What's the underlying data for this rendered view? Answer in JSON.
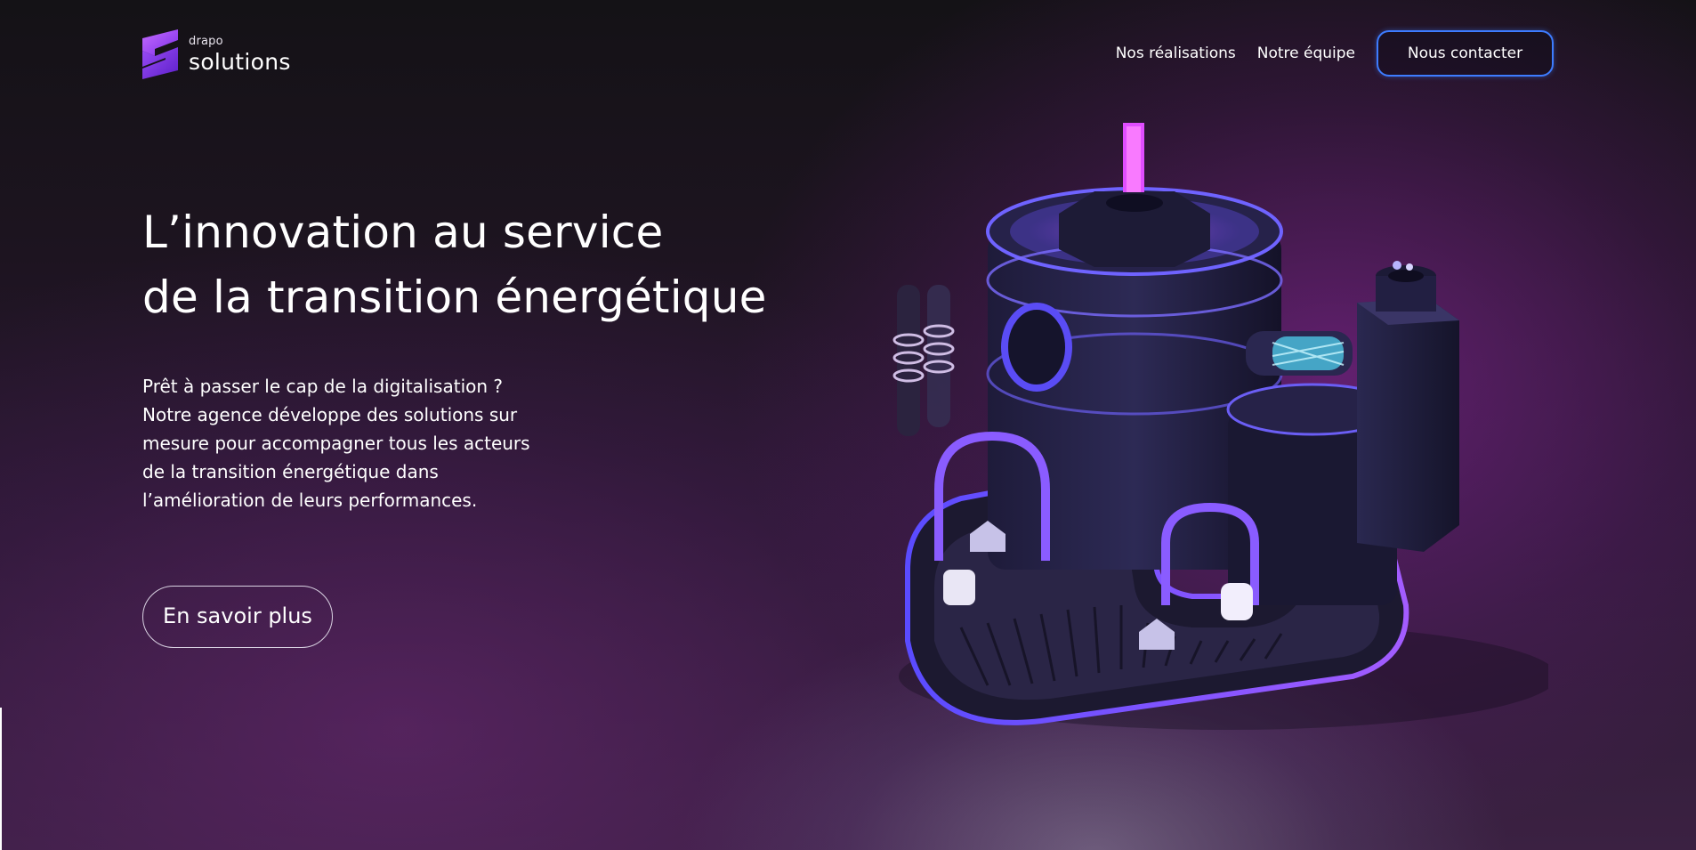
{
  "brand": {
    "small": "drapo",
    "big": "solutions",
    "logo_icon": "drapo-s-logo-icon",
    "accent": "#8b3df0"
  },
  "nav": {
    "links": [
      "Nos réalisations",
      "Notre équipe"
    ],
    "cta": "Nous contacter",
    "cta_border_color": "#3d7cff"
  },
  "hero": {
    "title_lines": [
      "L’innovation au service",
      "de la transition énergétique"
    ],
    "description_lines": [
      "Prêt à passer le cap de la digitalisation ?",
      "Notre agence développe des solutions sur",
      "mesure pour accompagner tous les acteurs",
      "de la transition énergétique dans",
      "l’amélioration de leurs performances."
    ],
    "button": "En savoir plus"
  },
  "illustration": {
    "subject": "3d-energy-factory-illustration"
  }
}
